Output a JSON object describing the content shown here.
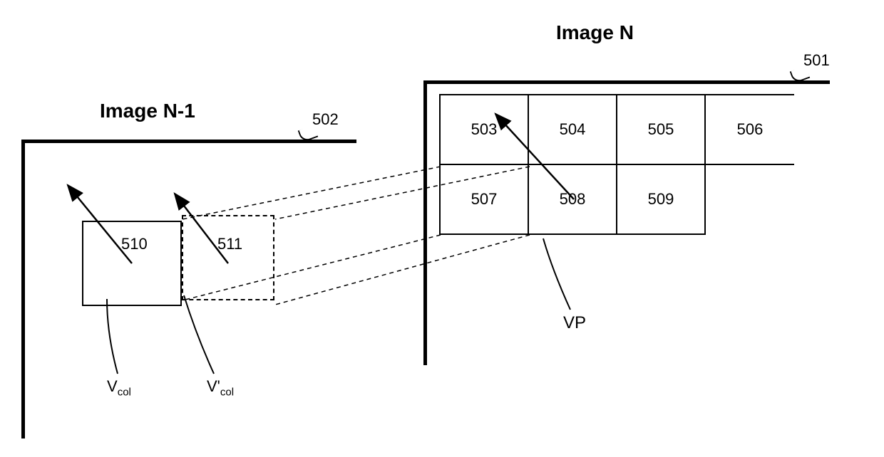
{
  "titles": {
    "right": "Image N",
    "left": "Image N-1"
  },
  "refs": {
    "r501": "501",
    "r502": "502"
  },
  "grid": {
    "r1c1": "503",
    "r1c2": "504",
    "r1c3": "505",
    "r1c4": "506",
    "r2c1": "507",
    "r2c2": "508",
    "r2c3": "509"
  },
  "blocks": {
    "b510": "510",
    "b511": "511"
  },
  "annotations": {
    "vp": "VP",
    "vcol_prefix": "V",
    "vcol_sub": "col",
    "vcol2_prefix": "V'",
    "vcol2_sub": "col"
  }
}
